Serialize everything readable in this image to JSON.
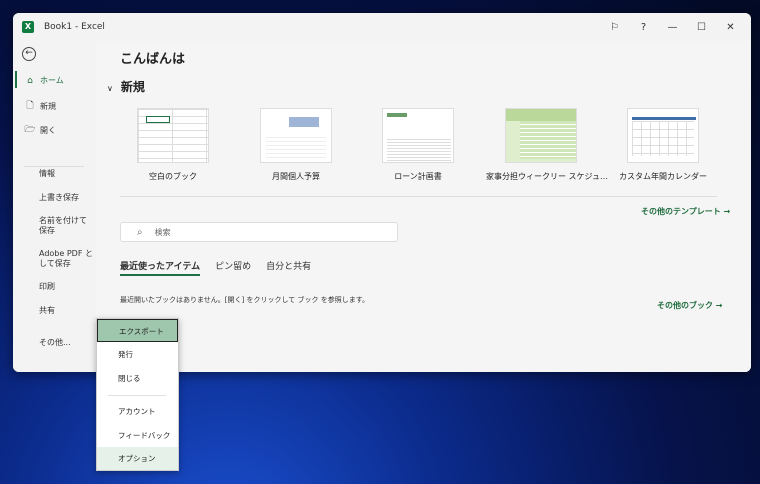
{
  "titlebar": {
    "title": "Book1  -  Excel",
    "app_icon": "X"
  },
  "sidebar": {
    "items": [
      {
        "label": "ホーム",
        "icon": "home-icon"
      },
      {
        "label": "新規",
        "icon": "file-icon"
      },
      {
        "label": "開く",
        "icon": "folder-icon"
      }
    ],
    "sub_items": [
      "情報",
      "上書き保存",
      "名前を付けて保存",
      "Adobe PDF として保存",
      "印刷",
      "共有",
      "その他..."
    ]
  },
  "main": {
    "greeting": "こんばんは",
    "new_heading": "新規",
    "templates": [
      "空白のブック",
      "月間個人予算",
      "ローン計画書",
      "家事分担ウィークリー スケジュ…",
      "カスタム年間カレンダー"
    ],
    "more_templates": "その他のテンプレート →",
    "search_placeholder": "検索",
    "tabs": [
      "最近使ったアイテム",
      "ピン留め",
      "自分と共有"
    ],
    "empty_message": "最近開いたブックはありません。[開く] をクリックして ブック を参照します。",
    "more_books": "その他のブック →"
  },
  "menu": {
    "items": [
      "エクスポート",
      "発行",
      "閉じる",
      "アカウント",
      "フィードバック",
      "オプション"
    ]
  }
}
